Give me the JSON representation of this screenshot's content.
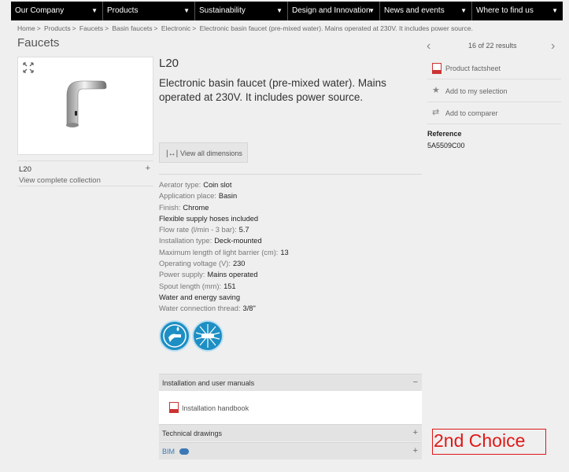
{
  "nav": {
    "items": [
      {
        "label": "Our Company"
      },
      {
        "label": "Products"
      },
      {
        "label": "Sustainability"
      },
      {
        "label": "Design and Innovation"
      },
      {
        "label": "News and events"
      },
      {
        "label": "Where to find us"
      }
    ]
  },
  "breadcrumb": [
    "Home",
    "Products",
    "Faucets",
    "Basin faucets",
    "Electronic",
    "Electronic basin faucet (pre-mixed water). Mains operated at 230V. It includes power source."
  ],
  "page_title": "Faucets",
  "pager": {
    "count_text": "16 of 22 results",
    "prev_icon": "chevron-left-icon",
    "next_icon": "chevron-right-icon"
  },
  "product": {
    "code": "L20",
    "description": "Electronic basin faucet (pre-mixed water). Mains operated at 230V. It includes power source.",
    "view_dimensions": "View all dimensions",
    "collection_name": "L20",
    "collection_link": "View complete collection"
  },
  "specs": [
    {
      "label": "Aerator type:",
      "value": "Coin slot"
    },
    {
      "label": "Application place:",
      "value": "Basin"
    },
    {
      "label": "Finish:",
      "value": "Chrome"
    },
    {
      "label": "Flexible supply hoses included",
      "value": ""
    },
    {
      "label": "Flow rate (l/min - 3 bar):",
      "value": "5.7"
    },
    {
      "label": "Installation type:",
      "value": "Deck-mounted"
    },
    {
      "label": "Maximum length of light barrier (cm):",
      "value": "13"
    },
    {
      "label": "Operating voltage (V):",
      "value": "230"
    },
    {
      "label": "Power supply:",
      "value": "Mains operated"
    },
    {
      "label": "Spout length (mm):",
      "value": "151"
    },
    {
      "label": "Water and energy saving",
      "value": ""
    },
    {
      "label": "Water connection thread:",
      "value": "3/8\""
    }
  ],
  "downloads": {
    "manuals_title": "Installation and user manuals",
    "manuals_toggle": "−",
    "handbook_link": "Installation handbook",
    "drawings_title": "Technical drawings",
    "drawings_toggle": "+",
    "bim_title": "BIM",
    "bim_toggle": "+"
  },
  "side": {
    "factsheet": "Product factsheet",
    "add_selection": "Add to my selection",
    "add_comparer": "Add to comparer",
    "reference_label": "Reference",
    "reference_value": "5A5509C00"
  },
  "stamp_text": "2nd Choice",
  "colors": {
    "nav_bg": "#000000",
    "feature_blue": "#1d8fc4",
    "stamp_red": "#e01818",
    "bim_blue": "#3b78b5"
  }
}
